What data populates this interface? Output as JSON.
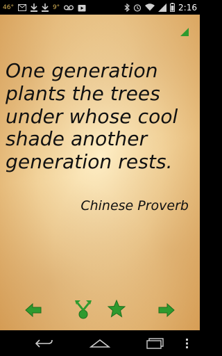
{
  "status_bar": {
    "temperature": "46°",
    "temp2": "9°",
    "time": "2:16",
    "icons": [
      "gmail-icon",
      "download-icon",
      "download-icon",
      "voicemail-icon",
      "play-store-icon",
      "bluetooth-icon",
      "alarm-icon",
      "wifi-icon",
      "signal-icon",
      "battery-icon"
    ]
  },
  "quote": {
    "text": "One generation plants the trees under whose cool shade another generation rests.",
    "author": "Chinese Proverb"
  },
  "colors": {
    "accent_green": "#2e9a2e",
    "text": "#111111",
    "status_text": "#cfcfcf"
  },
  "actions": {
    "previous": "left-arrow-icon",
    "share": "share-icon",
    "favorite": "star-icon",
    "next": "right-arrow-icon"
  },
  "nav": {
    "back": "back-icon",
    "home": "home-icon",
    "recents": "recents-icon",
    "menu": "overflow-menu-icon"
  }
}
